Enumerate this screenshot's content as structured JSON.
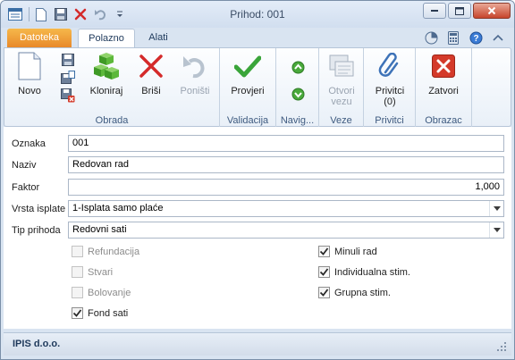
{
  "window": {
    "title": "Prihod: 001"
  },
  "tabs": {
    "file": "Datoteka",
    "items": [
      "Polazno",
      "Alati"
    ]
  },
  "ribbon": {
    "groups": {
      "obrada": "Obrada",
      "validacija": "Validacija",
      "navigacija": "Navig...",
      "veze": "Veze",
      "privitci": "Privitci",
      "obrazac": "Obrazac"
    },
    "buttons": {
      "novo": "Novo",
      "kloniraj": "Kloniraj",
      "brisi": "Briši",
      "ponisti": "Poništi",
      "provjeri": "Provjeri",
      "otvori_veze_1": "Otvori",
      "otvori_veze_2": "vezu",
      "privitci_1": "Privitci",
      "privitci_2": "(0)",
      "zatvori": "Zatvori"
    }
  },
  "form": {
    "oznaka": {
      "label": "Oznaka",
      "value": "001"
    },
    "naziv": {
      "label": "Naziv",
      "value": "Redovan rad"
    },
    "faktor": {
      "label": "Faktor",
      "value": "1,000"
    },
    "vrsta_isplate": {
      "label": "Vrsta isplate",
      "value": "1-Isplata samo plaće"
    },
    "tip_prihoda": {
      "label": "Tip prihoda",
      "value": "Redovni sati"
    },
    "checkboxes_left": [
      {
        "label": "Refundacija",
        "checked": false,
        "enabled": false
      },
      {
        "label": "Stvari",
        "checked": false,
        "enabled": false
      },
      {
        "label": "Bolovanje",
        "checked": false,
        "enabled": false
      },
      {
        "label": "Fond sati",
        "checked": true,
        "enabled": true
      }
    ],
    "checkboxes_right": [
      {
        "label": "Minuli rad",
        "checked": true,
        "enabled": true
      },
      {
        "label": "Individualna stim.",
        "checked": true,
        "enabled": true
      },
      {
        "label": "Grupna stim.",
        "checked": true,
        "enabled": true
      }
    ]
  },
  "status": {
    "company": "IPIS d.o.o."
  },
  "colors": {
    "accent_file_tab": "#e8892a",
    "delete_red": "#d42a2a",
    "check_green": "#3aa53a",
    "close_red": "#d43a2a"
  }
}
